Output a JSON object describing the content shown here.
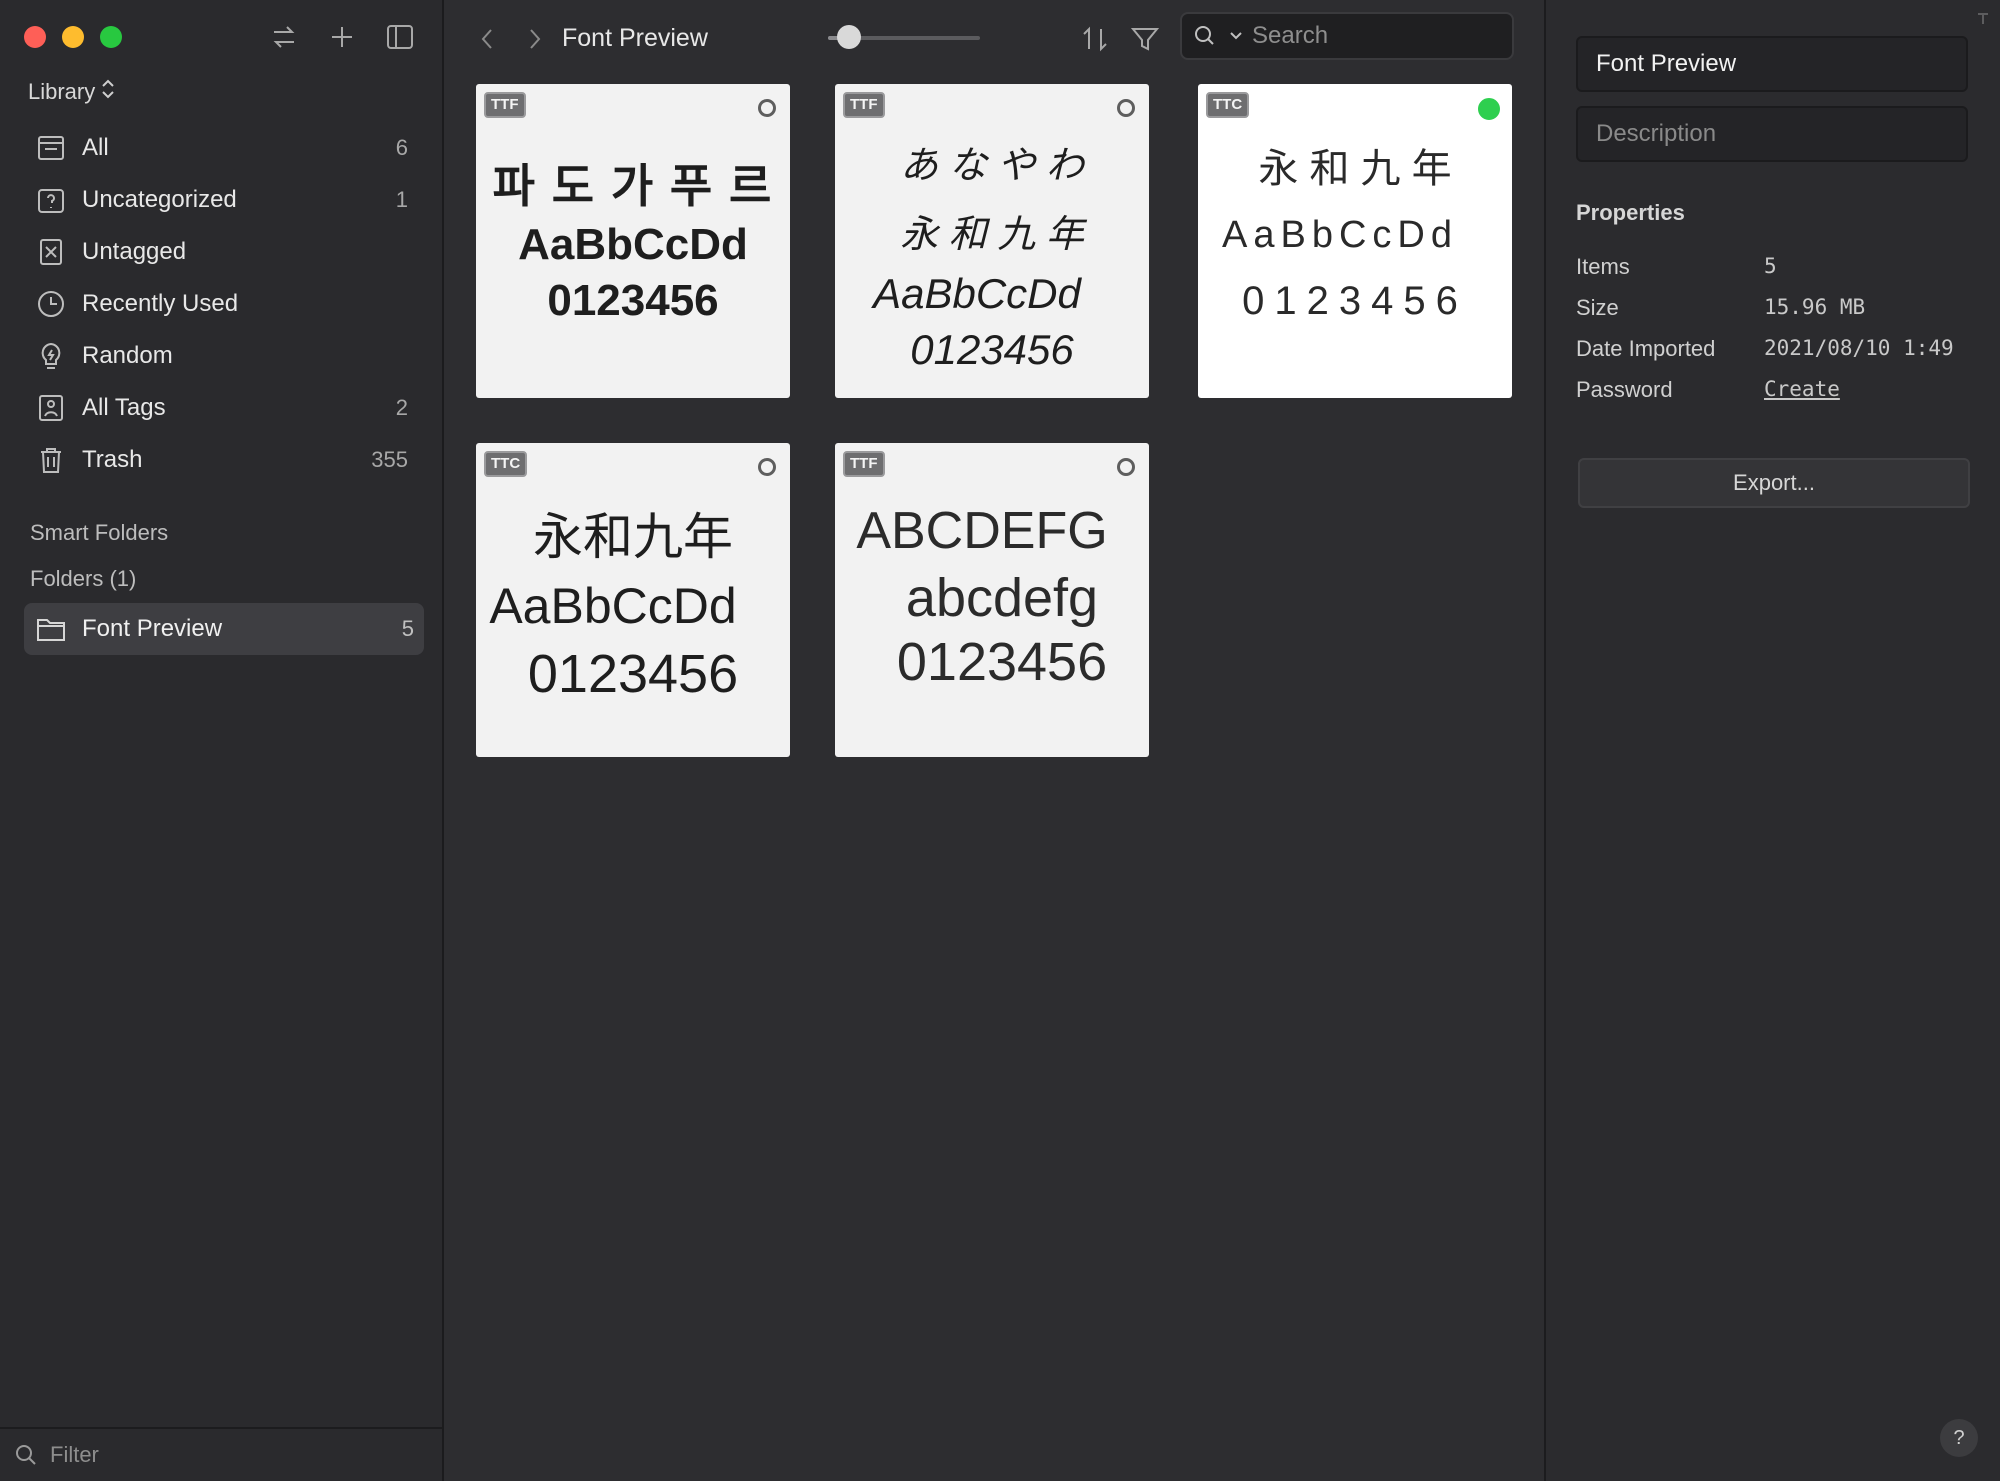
{
  "sidebar": {
    "library_label": "Library",
    "items": [
      {
        "label": "All",
        "count": "6",
        "icon": "inbox-icon"
      },
      {
        "label": "Uncategorized",
        "count": "1",
        "icon": "question-box-icon"
      },
      {
        "label": "Untagged",
        "count": "",
        "icon": "untagged-icon"
      },
      {
        "label": "Recently Used",
        "count": "",
        "icon": "clock-icon"
      },
      {
        "label": "Random",
        "count": "",
        "icon": "lightbulb-icon"
      },
      {
        "label": "All Tags",
        "count": "2",
        "icon": "tag-icon"
      },
      {
        "label": "Trash",
        "count": "355",
        "icon": "trash-icon"
      }
    ],
    "smart_folders_label": "Smart Folders",
    "folders_label": "Folders (1)",
    "folder": {
      "label": "Font Preview",
      "count": "5"
    },
    "filter_placeholder": "Filter"
  },
  "toolbar": {
    "title": "Font Preview",
    "search_placeholder": "Search",
    "zoom_level": 0.14
  },
  "cards": [
    {
      "badge": "TTF",
      "selected": false,
      "lines": [
        "파 도 가 푸 르",
        "AaBbCcDd",
        "0123456"
      ]
    },
    {
      "badge": "TTF",
      "selected": false,
      "lines": [
        "あ な や わ",
        "永 和 九 年",
        "AaBbCcDd",
        "0123456"
      ]
    },
    {
      "badge": "TTC",
      "selected": true,
      "lines": [
        "永 和 九 年",
        "AaBbCcDd",
        "0123456"
      ]
    },
    {
      "badge": "TTC",
      "selected": false,
      "lines": [
        "永和九年",
        "AaBbCcDd",
        "0123456"
      ]
    },
    {
      "badge": "TTF",
      "selected": false,
      "lines": [
        "ABCDEFG",
        "abcdefg",
        "0123456"
      ]
    }
  ],
  "panel": {
    "name": "Font Preview",
    "description_placeholder": "Description",
    "properties_title": "Properties",
    "properties": [
      {
        "key": "Items",
        "value": "5"
      },
      {
        "key": "Size",
        "value": "15.96 MB"
      },
      {
        "key": "Date Imported",
        "value": "2021/08/10 1:49"
      },
      {
        "key": "Password",
        "value": "Create"
      }
    ],
    "export_label": "Export...",
    "help_label": "?"
  },
  "colors": {
    "accent_green": "#2ecf4f",
    "close": "#fe5f57",
    "minimize": "#febc2e",
    "maximize": "#28c840"
  }
}
